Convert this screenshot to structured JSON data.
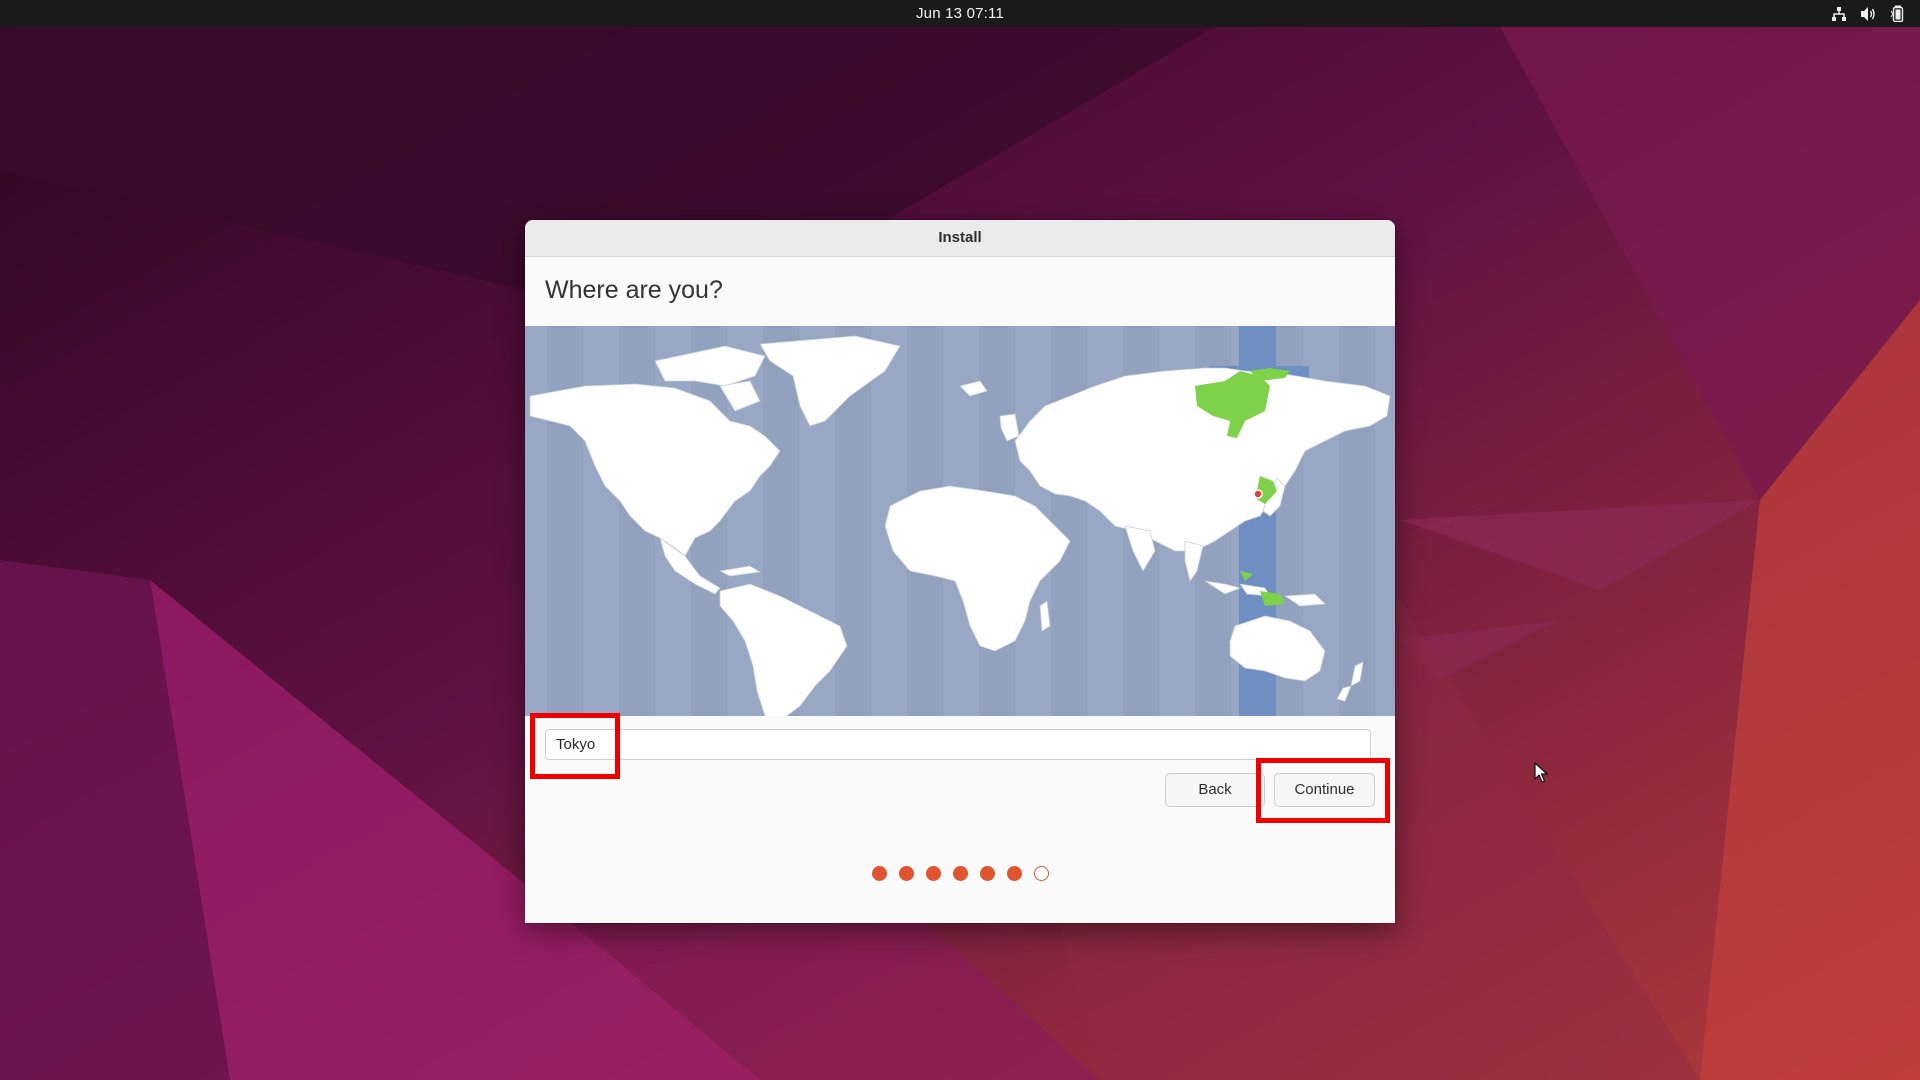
{
  "topbar": {
    "clock": "Jun 13  07:11",
    "icons": [
      "network-icon",
      "volume-icon",
      "battery-icon"
    ]
  },
  "window": {
    "title": "Install",
    "heading": "Where are you?"
  },
  "map": {
    "selected_location": "Tokyo",
    "highlight_color": "#7dd24a",
    "timezone_band_color": "#6f8fc3",
    "ocean_color": "#98a8c4",
    "pin_color": "#e04040"
  },
  "timezone_field": {
    "value": "Tokyo"
  },
  "buttons": {
    "back": "Back",
    "continue": "Continue"
  },
  "progress": {
    "total_steps": 7,
    "completed_steps": 6,
    "color": "#e0542f"
  },
  "annotations": {
    "highlight_color": "#f00000",
    "highlighted": [
      "timezone-input",
      "continue-button"
    ]
  }
}
